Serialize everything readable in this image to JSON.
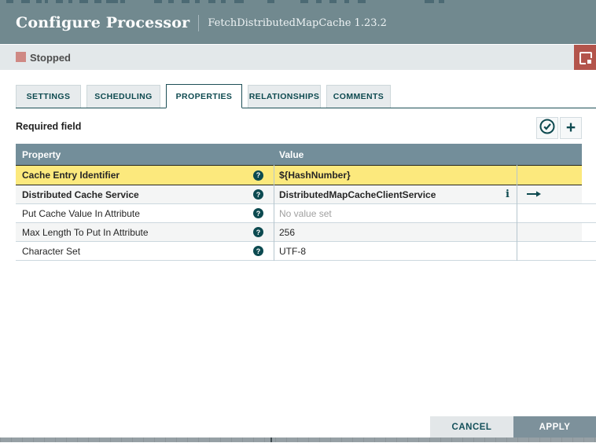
{
  "window": {
    "title": "Configure Processor",
    "subtitle": "FetchDistributedMapCache 1.23.2"
  },
  "status_bar": {
    "state": "Stopped"
  },
  "tabs": [
    {
      "label": "SETTINGS",
      "active": false
    },
    {
      "label": "SCHEDULING",
      "active": false
    },
    {
      "label": "PROPERTIES",
      "active": true
    },
    {
      "label": "RELATIONSHIPS",
      "active": false
    },
    {
      "label": "COMMENTS",
      "active": false
    }
  ],
  "properties_tab": {
    "required_field_label": "Required field",
    "table": {
      "columns": {
        "property": "Property",
        "value": "Value"
      },
      "rows": [
        {
          "property": "Cache Entry Identifier",
          "value": "${HashNumber}",
          "highlighted": true,
          "modified": true
        },
        {
          "property": "Distributed Cache Service",
          "value": "DistributedMapCacheClientService",
          "modified": true,
          "has_info": true,
          "has_goto": true
        },
        {
          "property": "Put Cache Value In Attribute",
          "value": "No value set",
          "placeholder": true
        },
        {
          "property": "Max Length To Put In Attribute",
          "value": "256"
        },
        {
          "property": "Character Set",
          "value": "UTF-8"
        }
      ]
    }
  },
  "footer": {
    "cancel": "CANCEL",
    "apply": "APPLY"
  },
  "icons": {
    "help_glyph": "?",
    "info_glyph": "i",
    "add_glyph": "+",
    "verify": "checkmark-circle-icon",
    "bulletin": "sticky-note-icon",
    "goto": "arrow-right-icon"
  },
  "colors": {
    "header_bg": "#71898f",
    "status_bar_bg": "#e3e8ea",
    "stopped_red": "#cf8984",
    "bulletin_red": "#b3544b",
    "accent_teal": "#0e4a50",
    "table_header_bg": "#738e9a",
    "highlight_yellow": "#fce97d",
    "alt_row": "#f4f5f5",
    "apply_bg": "#7d919b",
    "cancel_bg": "#e3e7e9"
  }
}
